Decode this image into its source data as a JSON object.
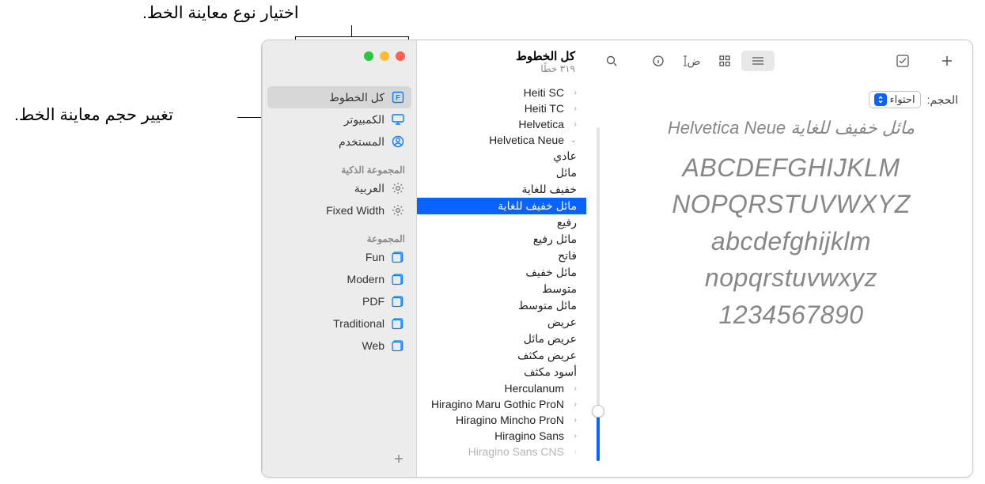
{
  "callouts": {
    "preview_type": "اختيار نوع معاينة الخط.",
    "preview_size": "تغيير حجم معاينة الخط."
  },
  "header": {
    "title": "كل الخطوط",
    "subtitle": "٣١٩ خطًا"
  },
  "sidebar": {
    "groups": [
      {
        "header": null,
        "items": [
          {
            "label": "كل الخطوط",
            "icon": "library",
            "selected": true
          },
          {
            "label": "الكمبيوتر",
            "icon": "computer",
            "selected": false
          },
          {
            "label": "المستخدم",
            "icon": "user",
            "selected": false
          }
        ]
      },
      {
        "header": "المجموعة الذكية",
        "items": [
          {
            "label": "العربية",
            "icon": "gear",
            "selected": false
          },
          {
            "label": "Fixed Width",
            "icon": "gear",
            "selected": false
          }
        ]
      },
      {
        "header": "المجموعة",
        "items": [
          {
            "label": "Fun",
            "icon": "folder",
            "selected": false
          },
          {
            "label": "Modern",
            "icon": "folder",
            "selected": false
          },
          {
            "label": "PDF",
            "icon": "folder",
            "selected": false
          },
          {
            "label": "Traditional",
            "icon": "folder",
            "selected": false
          },
          {
            "label": "Web",
            "icon": "folder",
            "selected": false
          }
        ]
      }
    ]
  },
  "fontlist": {
    "families": [
      {
        "name": "Heiti SC",
        "expanded": false
      },
      {
        "name": "Heiti TC",
        "expanded": false
      },
      {
        "name": "Helvetica",
        "expanded": false
      },
      {
        "name": "Helvetica Neue",
        "expanded": true,
        "styles": [
          {
            "name": "عادي",
            "selected": false
          },
          {
            "name": "مائل",
            "selected": false
          },
          {
            "name": "خفيف للغاية",
            "selected": false
          },
          {
            "name": "مائل خفيف للغاية",
            "selected": true
          },
          {
            "name": "رفيع",
            "selected": false
          },
          {
            "name": "مائل رفيع",
            "selected": false
          },
          {
            "name": "فاتح",
            "selected": false
          },
          {
            "name": "مائل خفيف",
            "selected": false
          },
          {
            "name": "متوسط",
            "selected": false
          },
          {
            "name": "مائل متوسط",
            "selected": false
          },
          {
            "name": "عريض",
            "selected": false
          },
          {
            "name": "عريض مائل",
            "selected": false
          },
          {
            "name": "عريض مكثف",
            "selected": false
          },
          {
            "name": "أسود مكثف",
            "selected": false
          }
        ]
      },
      {
        "name": "Herculanum",
        "expanded": false
      },
      {
        "name": "Hiragino Maru Gothic ProN",
        "expanded": false
      },
      {
        "name": "Hiragino Mincho ProN",
        "expanded": false
      },
      {
        "name": "Hiragino Sans",
        "expanded": false
      },
      {
        "name": "Hiragino Sans CNS",
        "expanded": false,
        "disabled": true
      }
    ]
  },
  "sizeRow": {
    "label": "الحجم:",
    "value": "احتواء"
  },
  "preview": {
    "title": "مائل خفيف للغاية Helvetica Neue",
    "lines": [
      "ABCDEFGHIJKLM",
      "NOPQRSTUVWXYZ",
      "abcdefghijklm",
      "nopqrstuvwxyz",
      "1234567890"
    ]
  }
}
